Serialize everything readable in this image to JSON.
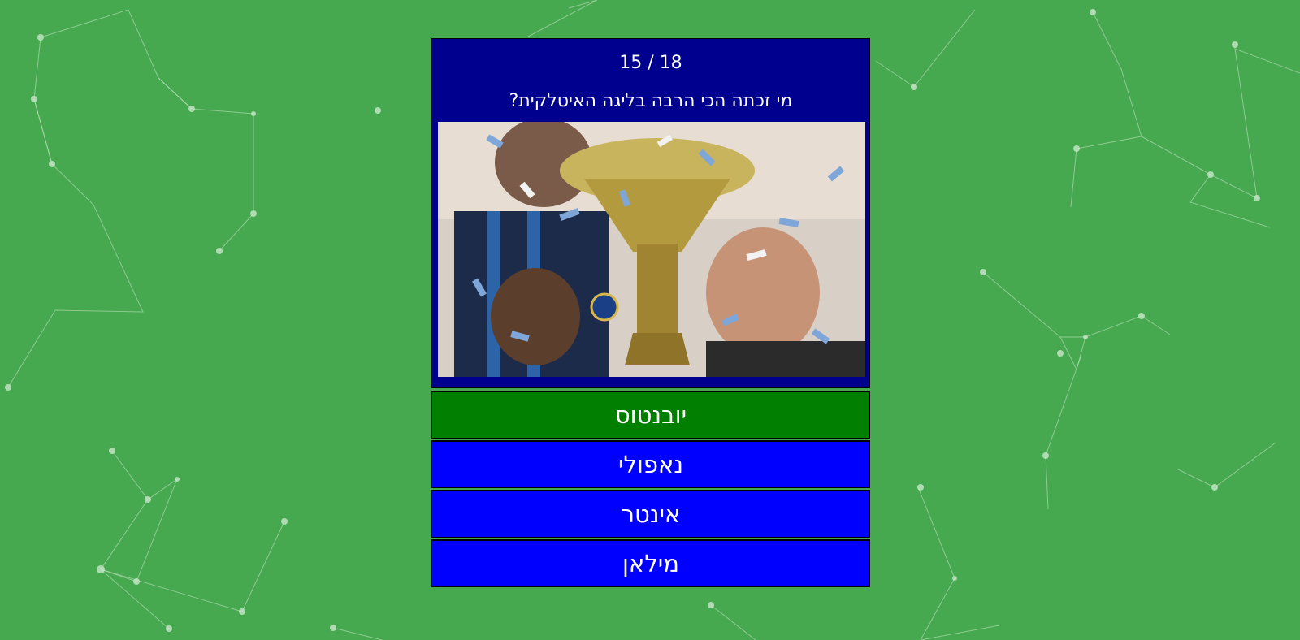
{
  "quiz": {
    "progress": "15 / 18",
    "question": "מי זכתה הכי הרבה בליגה האיטלקית?",
    "image_icon": "trophy-celebration-photo",
    "answers": [
      {
        "label": "יובנטוס",
        "state": "correct"
      },
      {
        "label": "נאפולי",
        "state": "normal"
      },
      {
        "label": "אינטר",
        "state": "normal"
      },
      {
        "label": "מילאן",
        "state": "normal"
      }
    ]
  },
  "colors": {
    "background": "#46a94f",
    "header": "#00008f",
    "correct": "#007f00",
    "answer": "#0000ff",
    "text": "#ffffff"
  }
}
